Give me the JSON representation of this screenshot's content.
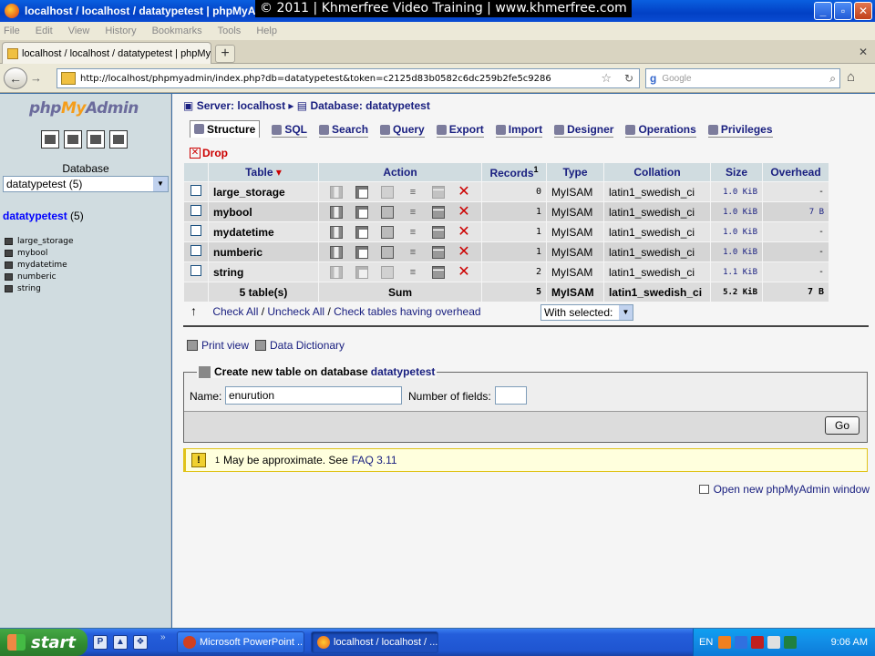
{
  "window": {
    "title": "localhost / localhost / datatypetest | phpMyA",
    "watermark": "© 2011 | Khmerfree Video Training | www.khmerfree.com",
    "controls": [
      "_",
      "▫",
      "✕"
    ]
  },
  "menu": [
    "File",
    "Edit",
    "View",
    "History",
    "Bookmarks",
    "Tools",
    "Help"
  ],
  "browser_tab": {
    "label": "localhost / localhost / datatypetest | phpMy...",
    "close": "✕"
  },
  "newtab_label": "+",
  "nav": {
    "url": "http://localhost/phpmyadmin/index.php?db=datatypetest&token=c2125d83b0582c6dc259b2fe5c9286",
    "search_placeholder": "Google"
  },
  "sidebar": {
    "logo_a": "php",
    "logo_b": "My",
    "logo_c": "Admin",
    "db_label": "Database",
    "db_select": "datatypetest (5)",
    "current_db": "datatypetest",
    "current_db_count": "(5)",
    "tables": [
      "large_storage",
      "mybool",
      "mydatetime",
      "numberic",
      "string"
    ]
  },
  "main": {
    "crumb_server": "Server: localhost",
    "crumb_db": "Database: datatypetest",
    "tabs": [
      "Structure",
      "SQL",
      "Search",
      "Query",
      "Export",
      "Import",
      "Designer",
      "Operations",
      "Privileges"
    ],
    "drop_tab": "Drop",
    "table_headers": {
      "table": "Table",
      "action": "Action",
      "records": "Records",
      "records_note": "1",
      "type": "Type",
      "collation": "Collation",
      "size": "Size",
      "overhead": "Overhead"
    },
    "rows": [
      {
        "name": "large_storage",
        "records": "0",
        "type": "MyISAM",
        "collation": "latin1_swedish_ci",
        "size": "1.0 KiB",
        "overhead": "-"
      },
      {
        "name": "mybool",
        "records": "1",
        "type": "MyISAM",
        "collation": "latin1_swedish_ci",
        "size": "1.0 KiB",
        "overhead": "7 B"
      },
      {
        "name": "mydatetime",
        "records": "1",
        "type": "MyISAM",
        "collation": "latin1_swedish_ci",
        "size": "1.0 KiB",
        "overhead": "-"
      },
      {
        "name": "numberic",
        "records": "1",
        "type": "MyISAM",
        "collation": "latin1_swedish_ci",
        "size": "1.0 KiB",
        "overhead": "-"
      },
      {
        "name": "string",
        "records": "2",
        "type": "MyISAM",
        "collation": "latin1_swedish_ci",
        "size": "1.1 KiB",
        "overhead": "-"
      }
    ],
    "sum_row": {
      "tables": "5 table(s)",
      "label": "Sum",
      "records": "5",
      "type": "MyISAM",
      "collation": "latin1_swedish_ci",
      "size": "5.2 KiB",
      "overhead": "7 B"
    },
    "check_all": "Check All",
    "uncheck_all": "Uncheck All",
    "check_overhead": "Check tables having overhead",
    "with_selected": "With selected:",
    "print_view": "Print view",
    "data_dictionary": "Data Dictionary",
    "create_legend": "Create new table on database",
    "create_db": "datatypetest",
    "name_label": "Name:",
    "name_value": "enurution",
    "fields_label": "Number of fields:",
    "go": "Go",
    "notice_sup": "1",
    "notice_text": "May be approximate. See",
    "notice_link": "FAQ 3.11",
    "open_window": "Open new phpMyAdmin window"
  },
  "taskbar": {
    "start": "start",
    "tasks": [
      "Microsoft PowerPoint ...",
      "localhost / localhost / ..."
    ],
    "lang": "EN",
    "clock": "9:06 AM"
  }
}
